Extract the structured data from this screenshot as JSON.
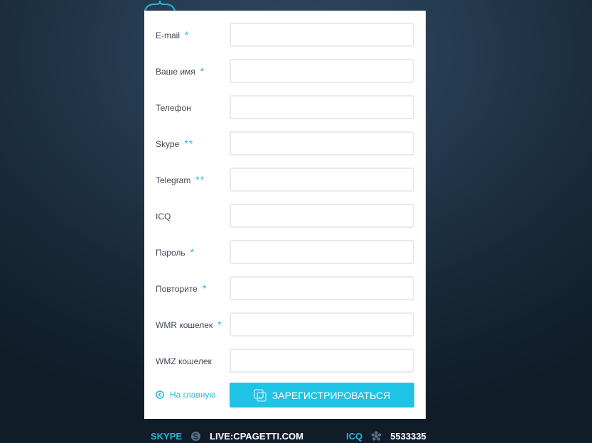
{
  "form": {
    "fields": [
      {
        "key": "email",
        "label": "E-mail",
        "req": "*",
        "value": ""
      },
      {
        "key": "name",
        "label": "Ваше имя",
        "req": "*",
        "value": ""
      },
      {
        "key": "phone",
        "label": "Телефон",
        "req": "",
        "value": ""
      },
      {
        "key": "skype",
        "label": "Skype",
        "req": "**",
        "value": ""
      },
      {
        "key": "telegram",
        "label": "Telegram",
        "req": "**",
        "value": ""
      },
      {
        "key": "icq",
        "label": "ICQ",
        "req": "",
        "value": ""
      },
      {
        "key": "password",
        "label": "Пароль",
        "req": "*",
        "value": ""
      },
      {
        "key": "repeat",
        "label": "Повторите",
        "req": "*",
        "value": ""
      },
      {
        "key": "wmr",
        "label": "WMR кошелек",
        "req": "*",
        "value": ""
      },
      {
        "key": "wmz",
        "label": "WMZ кошелек",
        "req": "",
        "value": ""
      }
    ],
    "home_link": "На главную",
    "submit_label": "ЗАРЕГИСТРИРОВАТЬСЯ"
  },
  "footer": {
    "skype_label": "SKYPE",
    "skype_value": "LIVE:CPAGETTI.COM",
    "icq_label": "ICQ",
    "icq_value": "5533335"
  },
  "icons": {
    "home": "circle-arrow-left-icon",
    "submit": "checkbox-icon",
    "skype": "skype-icon",
    "icq": "icq-flower-icon",
    "hanger": "hanger-icon"
  },
  "colors": {
    "accent": "#1ec3e6",
    "link": "#27b6d9",
    "background": "#1c2e40",
    "card": "#ffffff",
    "label": "#3d4752"
  }
}
